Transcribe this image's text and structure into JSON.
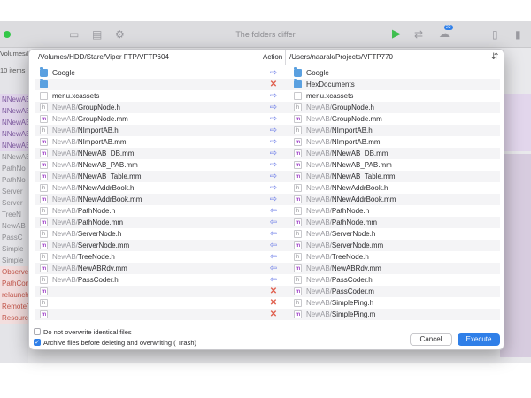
{
  "window": {
    "title": "The folders differ",
    "badge": "22"
  },
  "background": {
    "items_label": "10 items",
    "path_label": "Volumes/H",
    "rows": [
      {
        "text": "NNewAB_",
        "style": "purple"
      },
      {
        "text": "NNewAB_",
        "style": "purple"
      },
      {
        "text": "NNewAB_",
        "style": "purple"
      },
      {
        "text": "NNewAB_",
        "style": "purple"
      },
      {
        "text": "NNewAB_",
        "style": "purple"
      },
      {
        "text": "NNewAB",
        "style": "grey"
      },
      {
        "text": "PathNo",
        "style": "grey"
      },
      {
        "text": "PathNo",
        "style": "grey"
      },
      {
        "text": "Server",
        "style": "grey"
      },
      {
        "text": "Server",
        "style": "grey"
      },
      {
        "text": "TreeN",
        "style": "grey"
      },
      {
        "text": "NewAB",
        "style": "grey"
      },
      {
        "text": "PassC",
        "style": "grey"
      },
      {
        "text": "Simple",
        "style": "grey"
      },
      {
        "text": "Simple",
        "style": "grey"
      },
      {
        "text": "Observe",
        "style": "red"
      },
      {
        "text": "PathCon",
        "style": "red"
      },
      {
        "text": "relaunch",
        "style": "red"
      },
      {
        "text": "RemoteT",
        "style": "red"
      },
      {
        "text": "Resourc",
        "style": "red"
      }
    ]
  },
  "sheet": {
    "left_path": "/Volumes/HDD/Stare/Viper FTP/VFTP604",
    "action_header": "Action",
    "right_path": "/Users/naarak/Projects/VFTP770",
    "rows": [
      {
        "left_icon": "folder",
        "left_prefix": "",
        "left_name": "Google",
        "action": "right",
        "right_icon": "folder",
        "right_prefix": "",
        "right_name": "Google"
      },
      {
        "left_icon": "folder",
        "left_prefix": "",
        "left_name": "",
        "action": "delete",
        "right_icon": "folder",
        "right_prefix": "",
        "right_name": "HexDocuments"
      },
      {
        "left_icon": "doc",
        "left_prefix": "",
        "left_name": "menu.xcassets",
        "action": "right",
        "right_icon": "doc",
        "right_prefix": "",
        "right_name": "menu.xcassets"
      },
      {
        "left_icon": "h",
        "left_prefix": "NewAB/",
        "left_name": "GroupNode.h",
        "action": "right",
        "right_icon": "h",
        "right_prefix": "NewAB/",
        "right_name": "GroupNode.h"
      },
      {
        "left_icon": "m",
        "left_prefix": "NewAB/",
        "left_name": "GroupNode.mm",
        "action": "right",
        "right_icon": "m",
        "right_prefix": "NewAB/",
        "right_name": "GroupNode.mm"
      },
      {
        "left_icon": "h",
        "left_prefix": "NewAB/",
        "left_name": "NImportAB.h",
        "action": "right",
        "right_icon": "h",
        "right_prefix": "NewAB/",
        "right_name": "NImportAB.h"
      },
      {
        "left_icon": "m",
        "left_prefix": "NewAB/",
        "left_name": "NImportAB.mm",
        "action": "right",
        "right_icon": "m",
        "right_prefix": "NewAB/",
        "right_name": "NImportAB.mm"
      },
      {
        "left_icon": "m",
        "left_prefix": "NewAB/",
        "left_name": "NNewAB_DB.mm",
        "action": "right",
        "right_icon": "m",
        "right_prefix": "NewAB/",
        "right_name": "NNewAB_DB.mm"
      },
      {
        "left_icon": "m",
        "left_prefix": "NewAB/",
        "left_name": "NNewAB_PAB.mm",
        "action": "right",
        "right_icon": "m",
        "right_prefix": "NewAB/",
        "right_name": "NNewAB_PAB.mm"
      },
      {
        "left_icon": "m",
        "left_prefix": "NewAB/",
        "left_name": "NNewAB_Table.mm",
        "action": "right",
        "right_icon": "m",
        "right_prefix": "NewAB/",
        "right_name": "NNewAB_Table.mm"
      },
      {
        "left_icon": "h",
        "left_prefix": "NewAB/",
        "left_name": "NNewAddrBook.h",
        "action": "right",
        "right_icon": "h",
        "right_prefix": "NewAB/",
        "right_name": "NNewAddrBook.h"
      },
      {
        "left_icon": "m",
        "left_prefix": "NewAB/",
        "left_name": "NNewAddrBook.mm",
        "action": "right",
        "right_icon": "m",
        "right_prefix": "NewAB/",
        "right_name": "NNewAddrBook.mm"
      },
      {
        "left_icon": "h",
        "left_prefix": "NewAB/",
        "left_name": "PathNode.h",
        "action": "left",
        "right_icon": "h",
        "right_prefix": "NewAB/",
        "right_name": "PathNode.h"
      },
      {
        "left_icon": "m",
        "left_prefix": "NewAB/",
        "left_name": "PathNode.mm",
        "action": "left",
        "right_icon": "m",
        "right_prefix": "NewAB/",
        "right_name": "PathNode.mm"
      },
      {
        "left_icon": "h",
        "left_prefix": "NewAB/",
        "left_name": "ServerNode.h",
        "action": "left",
        "right_icon": "h",
        "right_prefix": "NewAB/",
        "right_name": "ServerNode.h"
      },
      {
        "left_icon": "m",
        "left_prefix": "NewAB/",
        "left_name": "ServerNode.mm",
        "action": "left",
        "right_icon": "m",
        "right_prefix": "NewAB/",
        "right_name": "ServerNode.mm"
      },
      {
        "left_icon": "h",
        "left_prefix": "NewAB/",
        "left_name": "TreeNode.h",
        "action": "left",
        "right_icon": "h",
        "right_prefix": "NewAB/",
        "right_name": "TreeNode.h"
      },
      {
        "left_icon": "m",
        "left_prefix": "NewAB/",
        "left_name": "NewABRdv.mm",
        "action": "left",
        "right_icon": "m",
        "right_prefix": "NewAB/",
        "right_name": "NewABRdv.mm"
      },
      {
        "left_icon": "h",
        "left_prefix": "NewAB/",
        "left_name": "PassCoder.h",
        "action": "left",
        "right_icon": "h",
        "right_prefix": "NewAB/",
        "right_name": "PassCoder.h"
      },
      {
        "left_icon": "m",
        "left_prefix": "",
        "left_name": "",
        "action": "delete",
        "right_icon": "m",
        "right_prefix": "NewAB/",
        "right_name": "PassCoder.m"
      },
      {
        "left_icon": "h",
        "left_prefix": "",
        "left_name": "",
        "action": "delete",
        "right_icon": "h",
        "right_prefix": "NewAB/",
        "right_name": "SimplePing.h"
      },
      {
        "left_icon": "m",
        "left_prefix": "",
        "left_name": "",
        "action": "delete",
        "right_icon": "m",
        "right_prefix": "NewAB/",
        "right_name": "SimplePing.m"
      }
    ],
    "options": {
      "no_overwrite_label": "Do not overwrite identical files",
      "no_overwrite_checked": false,
      "archive_label": "Archive files before deleting and overwriting ( Trash)",
      "archive_checked": true
    },
    "buttons": {
      "cancel": "Cancel",
      "execute": "Execute"
    }
  },
  "icons": {
    "action_right": "arrow-right-icon",
    "action_left": "arrow-left-icon",
    "action_delete": "delete-x-icon",
    "sort": "sort-icon"
  },
  "colors": {
    "accent": "#2f7fe8",
    "delete": "#e0604f",
    "arrow": "#6f7fe8",
    "objc_m": "#a043c8",
    "folder": "#5aa0e0"
  }
}
